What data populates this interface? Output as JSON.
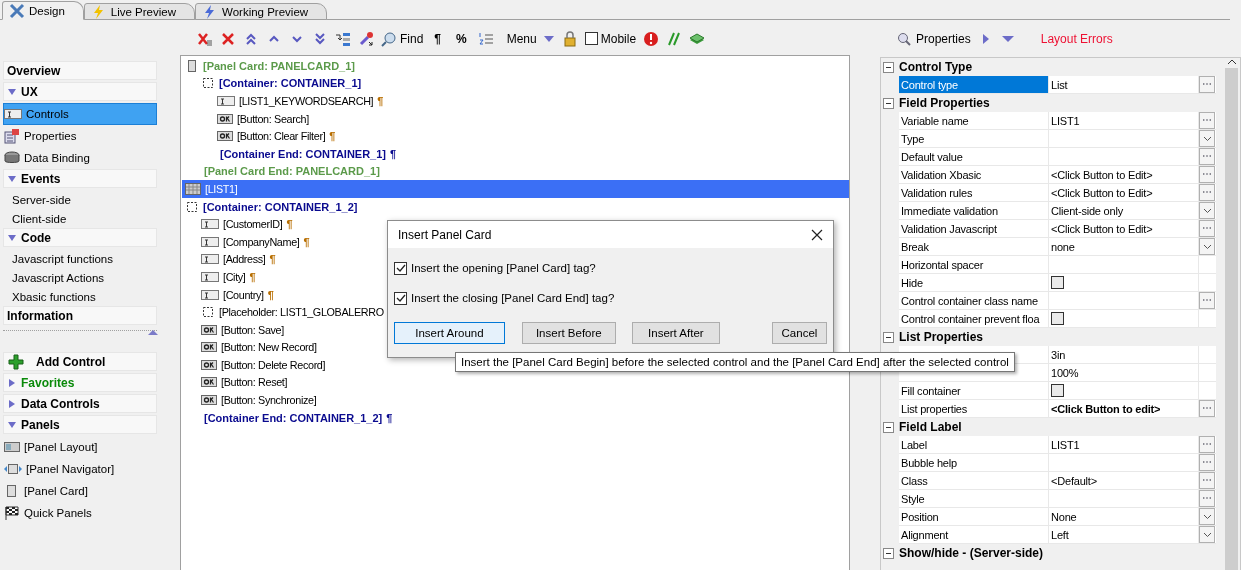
{
  "tabs": [
    {
      "label": "Design",
      "selected": true
    },
    {
      "label": "Live Preview",
      "selected": false
    },
    {
      "label": "Working Preview",
      "selected": false
    }
  ],
  "toolbar": {
    "find": "Find",
    "pilcrow": "¶",
    "percent": "%",
    "menu": "Menu",
    "mobile": {
      "label": "Mobile",
      "checked": false
    }
  },
  "sidebar": {
    "top": [
      {
        "kind": "header",
        "label": "Overview"
      },
      {
        "kind": "group",
        "label": "UX",
        "expanded": true
      },
      {
        "kind": "icon-item",
        "label": "Controls",
        "selected": true
      },
      {
        "kind": "icon-item",
        "label": "Properties",
        "selected": false
      },
      {
        "kind": "icon-item",
        "label": "Data Binding",
        "selected": false
      },
      {
        "kind": "group",
        "label": "Events",
        "expanded": true
      },
      {
        "kind": "text-item",
        "label": "Server-side",
        "selected": false
      },
      {
        "kind": "text-item",
        "label": "Client-side",
        "selected": false
      },
      {
        "kind": "group",
        "label": "Code",
        "expanded": true
      },
      {
        "kind": "text-item",
        "label": "Javascript functions",
        "selected": false
      },
      {
        "kind": "text-item",
        "label": "Javascript Actions",
        "selected": false
      },
      {
        "kind": "text-item",
        "label": "Xbasic functions",
        "selected": false
      },
      {
        "kind": "header",
        "label": "Information"
      }
    ],
    "bottom": [
      {
        "kind": "action",
        "label": "Add Control"
      },
      {
        "kind": "group",
        "label": "Favorites",
        "expanded": false,
        "color": "#0a8a0a"
      },
      {
        "kind": "group",
        "label": "Data Controls",
        "expanded": false
      },
      {
        "kind": "group",
        "label": "Panels",
        "expanded": true
      },
      {
        "kind": "icon-item",
        "label": "[Panel Layout]",
        "selected": false
      },
      {
        "kind": "icon-item",
        "label": "[Panel Navigator]",
        "selected": false
      },
      {
        "kind": "icon-item",
        "label": "[Panel Card]",
        "selected": false
      },
      {
        "kind": "icon-item",
        "label": "Quick Panels",
        "selected": false
      }
    ]
  },
  "tree": [
    {
      "kind": "panel-card",
      "label": "[Panel Card: PANELCARD_1]",
      "selected": false,
      "children": [
        {
          "kind": "container",
          "label": "[Container: CONTAINER_1]",
          "selected": false,
          "children": [
            {
              "kind": "input",
              "label": "[LIST1_KEYWORDSEARCH]",
              "mark": "¶",
              "selected": false
            },
            {
              "kind": "button",
              "label": "[Button: Search]",
              "selected": false
            },
            {
              "kind": "button",
              "label": "[Button: Clear Filter]",
              "mark": "¶",
              "selected": false
            },
            {
              "kind": "container-end",
              "label": "[Container End: CONTAINER_1]",
              "mark": "¶",
              "selected": false
            }
          ]
        },
        {
          "kind": "panel-card-end",
          "label": "[Panel Card End: PANELCARD_1]",
          "selected": false
        }
      ]
    },
    {
      "kind": "list",
      "label": "[LIST1]",
      "selected": true
    },
    {
      "kind": "container",
      "label": "[Container: CONTAINER_1_2]",
      "selected": false,
      "children": [
        {
          "kind": "input",
          "label": "[CustomerID]",
          "mark": "¶",
          "selected": false
        },
        {
          "kind": "input",
          "label": "[CompanyName]",
          "mark": "¶",
          "selected": false
        },
        {
          "kind": "input",
          "label": "[Address]",
          "mark": "¶",
          "selected": false
        },
        {
          "kind": "input",
          "label": "[City]",
          "mark": "¶",
          "selected": false
        },
        {
          "kind": "input",
          "label": "[Country]",
          "mark": "¶",
          "selected": false
        },
        {
          "kind": "placeholder",
          "label": "[Placeholder: LIST1_GLOBALERRO",
          "selected": false
        },
        {
          "kind": "button",
          "label": "[Button: Save]",
          "selected": false
        },
        {
          "kind": "button",
          "label": "[Button: New Record]",
          "selected": false
        },
        {
          "kind": "button",
          "label": "[Button: Delete Record]",
          "selected": false
        },
        {
          "kind": "button",
          "label": "[Button: Reset]",
          "selected": false
        },
        {
          "kind": "button",
          "label": "[Button: Synchronize]",
          "selected": false
        },
        {
          "kind": "container-end",
          "label": "[Container End: CONTAINER_1_2]",
          "mark": "¶",
          "selected": false
        }
      ]
    }
  ],
  "dialog": {
    "title": "Insert Panel Card",
    "checkboxes": [
      {
        "label": "Insert the opening [Panel Card] tag?",
        "checked": true
      },
      {
        "label": "Insert the closing [Panel Card End] tag?",
        "checked": true
      }
    ],
    "buttons": [
      {
        "label": "Insert Around",
        "selected": true
      },
      {
        "label": "Insert Before",
        "selected": false
      },
      {
        "label": "Insert After",
        "selected": false
      },
      {
        "label": "Cancel",
        "selected": false
      }
    ]
  },
  "tooltip": "Insert the [Panel Card Begin] before the selected control and the [Panel Card End] after the selected control",
  "properties": {
    "title": "Properties",
    "errors": "Layout Errors",
    "sections": [
      {
        "title": "Control Type",
        "expanded": true,
        "rows": [
          {
            "label": "Control type",
            "value": "List",
            "kind": "dots",
            "selected": true,
            "bold": false
          }
        ]
      },
      {
        "title": "Field Properties",
        "expanded": true,
        "rows": [
          {
            "label": "Variable name",
            "value": "LIST1",
            "kind": "dots",
            "selected": false,
            "bold": false
          },
          {
            "label": "Type",
            "kind": "dropdown",
            "selected": false
          },
          {
            "label": "Default value",
            "kind": "dots",
            "selected": false
          },
          {
            "label": "Validation Xbasic",
            "value": "<Click Button to Edit>",
            "kind": "dots",
            "selected": false,
            "bold": false
          },
          {
            "label": "Validation rules",
            "value": "<Click Button to Edit>",
            "kind": "dots",
            "selected": false,
            "bold": false
          },
          {
            "label": "Immediate validation",
            "value": "Client-side only",
            "kind": "dropdown",
            "selected": false,
            "bold": false
          },
          {
            "label": "Validation Javascript",
            "value": "<Click Button to Edit>",
            "kind": "dots",
            "selected": false,
            "bold": false
          },
          {
            "label": "Break",
            "value": "none",
            "kind": "dropdown",
            "selected": false,
            "bold": false
          },
          {
            "label": "Horizontal spacer",
            "kind": "plain",
            "selected": false
          },
          {
            "label": "Hide",
            "kind": "checkbox",
            "checked": false,
            "selected": false
          },
          {
            "label": "Control container class name",
            "kind": "dots",
            "selected": false
          },
          {
            "label": "Control container prevent floa",
            "kind": "checkbox",
            "checked": false,
            "selected": false
          }
        ]
      },
      {
        "title": "List Properties",
        "expanded": true,
        "rows": [
          {
            "value": "3in",
            "kind": "plain",
            "selected": false,
            "bold": false
          },
          {
            "value": "100%",
            "kind": "plain",
            "selected": false,
            "bold": false
          },
          {
            "label": "Fill container",
            "kind": "checkbox",
            "checked": false,
            "selected": false
          },
          {
            "label": "List properties",
            "value": "<Click Button to edit>",
            "kind": "dots",
            "selected": false,
            "bold": true
          }
        ]
      },
      {
        "title": "Field Label",
        "expanded": true,
        "rows": [
          {
            "label": "Label",
            "value": "LIST1",
            "kind": "dots",
            "selected": false,
            "bold": false
          },
          {
            "label": "Bubble help",
            "kind": "dots",
            "selected": false
          },
          {
            "label": "Class",
            "value": "<Default>",
            "kind": "dots",
            "selected": false,
            "bold": false
          },
          {
            "label": "Style",
            "kind": "dots",
            "selected": false
          },
          {
            "label": "Position",
            "value": "None",
            "kind": "dropdown",
            "selected": false,
            "bold": false
          },
          {
            "label": "Alignment",
            "value": "Left",
            "kind": "dropdown",
            "selected": false,
            "bold": false
          }
        ]
      },
      {
        "title": "Show/hide - (Server-side)",
        "expanded": true
      }
    ]
  }
}
